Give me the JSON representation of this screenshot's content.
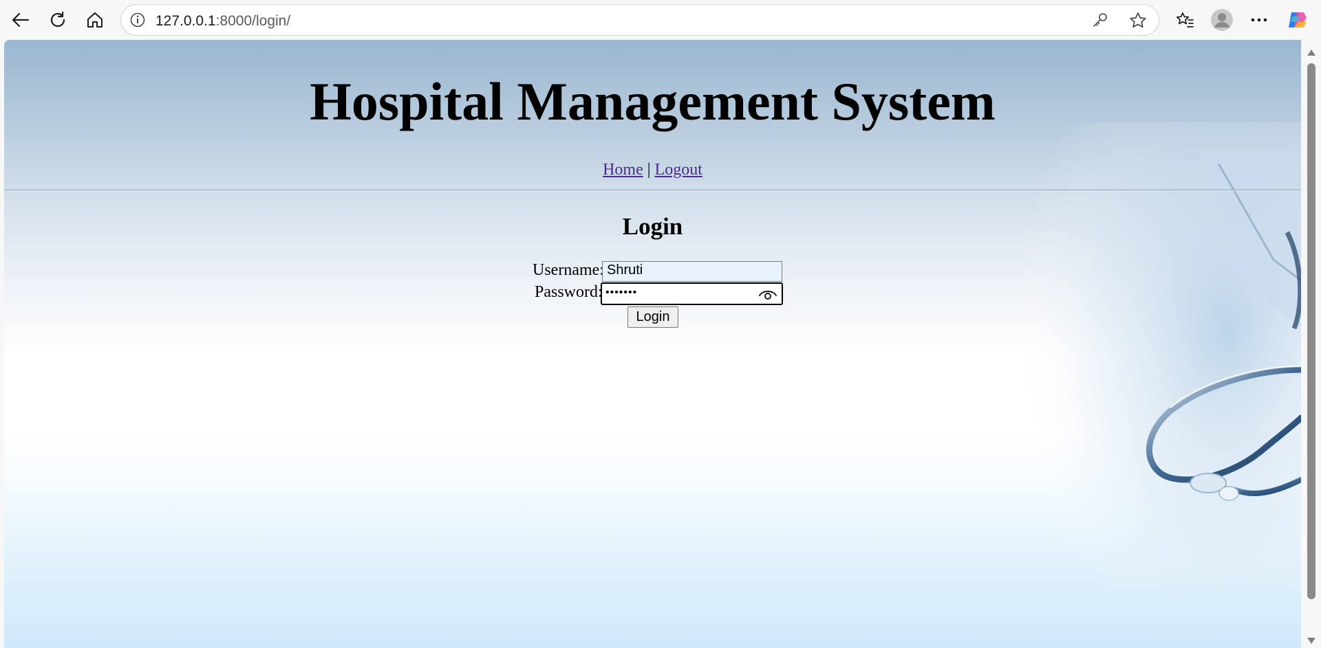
{
  "browser": {
    "url_host": "127.0.0.1",
    "url_rest": ":8000/login/",
    "icons": [
      "back-arrow-icon",
      "refresh-icon",
      "home-icon",
      "info-icon",
      "key-icon",
      "star-icon",
      "favorites-icon",
      "profile-icon",
      "more-icon",
      "copilot-icon"
    ]
  },
  "page": {
    "title": "Hospital Management System",
    "nav": {
      "home": "Home",
      "separator": "|",
      "logout": "Logout"
    },
    "login": {
      "heading": "Login",
      "username_label": "Username:",
      "username_value": "Shruti",
      "password_label": "Password:",
      "password_mask": "•••••••",
      "submit": "Login"
    }
  },
  "colors": {
    "link": "#4b2a8f",
    "header_gradient_top": "#9ab6d0",
    "footer_gradient": "#d0e8fb",
    "username_autofill_bg": "#e9f0fe"
  }
}
